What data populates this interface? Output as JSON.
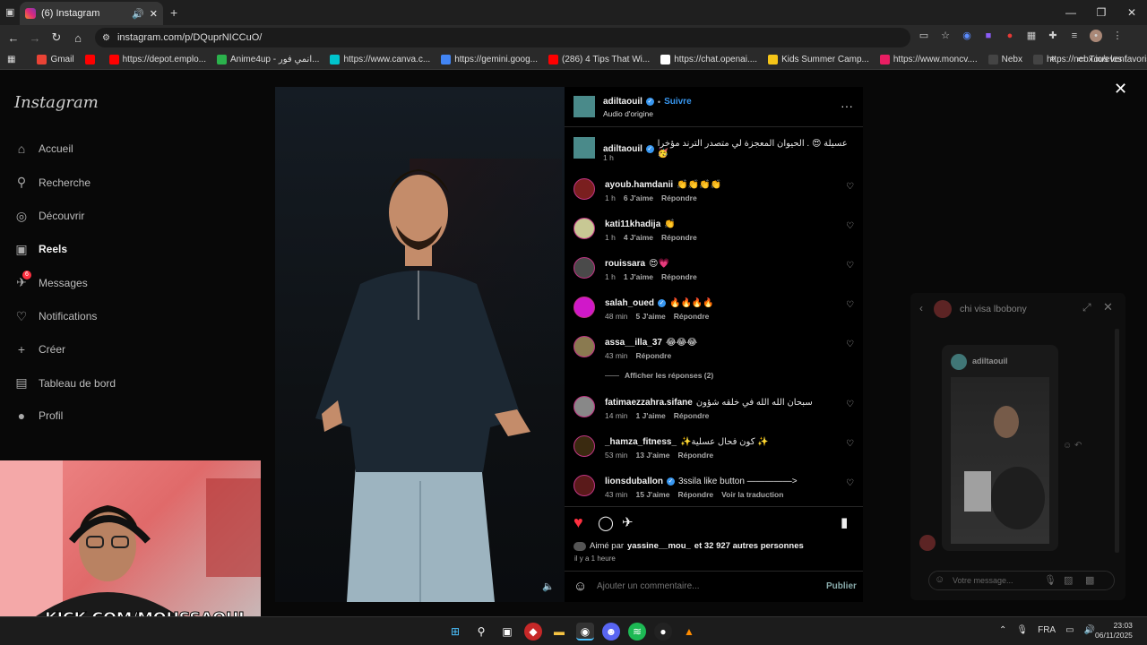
{
  "browser": {
    "tab_title": "(6) Instagram",
    "url": "instagram.com/p/DQuprNICCuO/",
    "bookmarks": [
      {
        "label": "Gmail",
        "color": "#ea4335"
      },
      {
        "label": "",
        "color": "#ff0000"
      },
      {
        "label": "https://depot.emplo...",
        "color": "#ff0000"
      },
      {
        "label": "Anime4up - انمي فور...",
        "color": "#2bb24c"
      },
      {
        "label": "https://www.canva.c...",
        "color": "#00c4cc"
      },
      {
        "label": "https://gemini.goog...",
        "color": "#4285f4"
      },
      {
        "label": "(286) 4 Tips That Wi...",
        "color": "#ff0000"
      },
      {
        "label": "https://chat.openai....",
        "color": "#ffffff"
      },
      {
        "label": "Kids Summer Camp...",
        "color": "#f5c518"
      },
      {
        "label": "https://www.moncv....",
        "color": "#e91e63"
      },
      {
        "label": "Nebx",
        "color": "#444444"
      },
      {
        "label": "https://nebx.io/event",
        "color": "#444444"
      }
    ],
    "all_bookmarks": "Tous les favoris"
  },
  "sidebar": {
    "logo": "Instagram",
    "items": [
      {
        "label": "Accueil",
        "icon": "home-icon",
        "glyph": "⌂"
      },
      {
        "label": "Recherche",
        "icon": "search-icon",
        "glyph": "⚲"
      },
      {
        "label": "Découvrir",
        "icon": "compass-icon",
        "glyph": "◎"
      },
      {
        "label": "Reels",
        "icon": "reels-icon",
        "glyph": "▣"
      },
      {
        "label": "Messages",
        "icon": "messages-icon",
        "glyph": "✈",
        "badge": "6"
      },
      {
        "label": "Notifications",
        "icon": "heart-icon",
        "glyph": "♡"
      },
      {
        "label": "Créer",
        "icon": "plus-icon",
        "glyph": "+"
      },
      {
        "label": "Tableau de bord",
        "icon": "dashboard-icon",
        "glyph": "▤"
      },
      {
        "label": "Profil",
        "icon": "profile-icon",
        "glyph": "●"
      }
    ]
  },
  "post": {
    "author": "adiltaouil",
    "follow": "Suivre",
    "audio": "Audio d'origine",
    "caption": "عسيلة 😍 . الحيوان المعجزة لي متصدر الترند مؤخرا 🥳",
    "caption_time": "1 h",
    "comments": [
      {
        "user": "ayoub.hamdanii",
        "text": "👏👏👏👏",
        "time": "1 h",
        "likes": "6 J'aime",
        "reply": "Répondre",
        "verified": false,
        "avatar": "#7a1f1f"
      },
      {
        "user": "kati11khadija",
        "text": "👏",
        "time": "1 h",
        "likes": "4 J'aime",
        "reply": "Répondre",
        "verified": false,
        "avatar": "#c8c894"
      },
      {
        "user": "rouissara",
        "text": "😍💗",
        "time": "1 h",
        "likes": "1 J'aime",
        "reply": "Répondre",
        "verified": false,
        "avatar": "#4a4a4a"
      },
      {
        "user": "salah_oued",
        "text": "🔥🔥🔥🔥",
        "time": "48 min",
        "likes": "5 J'aime",
        "reply": "Répondre",
        "verified": true,
        "avatar": "#d018c9"
      },
      {
        "user": "assa__illa_37",
        "text": "😂😂😂",
        "time": "43 min",
        "likes": "",
        "reply": "Répondre",
        "verified": false,
        "avatar": "#8a7a50"
      },
      {
        "user": "fatimaezzahra.sifane",
        "text": "سبحان الله الله في خلقه شؤون",
        "time": "14 min",
        "likes": "1 J'aime",
        "reply": "Répondre",
        "verified": false,
        "avatar": "#888888"
      },
      {
        "user": "_hamza_fitness_",
        "text": "✨كون فحال عسلية ✨",
        "time": "53 min",
        "likes": "13 J'aime",
        "reply": "Répondre",
        "verified": false,
        "avatar": "#3a2a10"
      },
      {
        "user": "lionsduballon",
        "text": "3ssila like button —————>",
        "time": "43 min",
        "likes": "15 J'aime",
        "reply": "Répondre",
        "verified": true,
        "translate": "Voir la traduction",
        "avatar": "#5a1a1a"
      }
    ],
    "view_replies": "Afficher les réponses (2)",
    "liked_by_prefix": "Aimé par",
    "liked_by_user": "yassine__mou_",
    "liked_by_suffix": "et 32 927 autres personnes",
    "posted": "il y a 1 heure",
    "comment_placeholder": "Ajouter un commentaire...",
    "publish": "Publier"
  },
  "chat": {
    "title": "chi visa lbobony",
    "shared_user": "adiltaouil",
    "placeholder": "Votre message..."
  },
  "stream": {
    "overlay": "KICK.COM/MOUSSAOUI"
  },
  "taskbar": {
    "lang": "FRA",
    "time": "23:03",
    "date": "06/11/2025"
  },
  "colors": {
    "like_red": "#ff3040",
    "link_blue": "#3897f0"
  }
}
